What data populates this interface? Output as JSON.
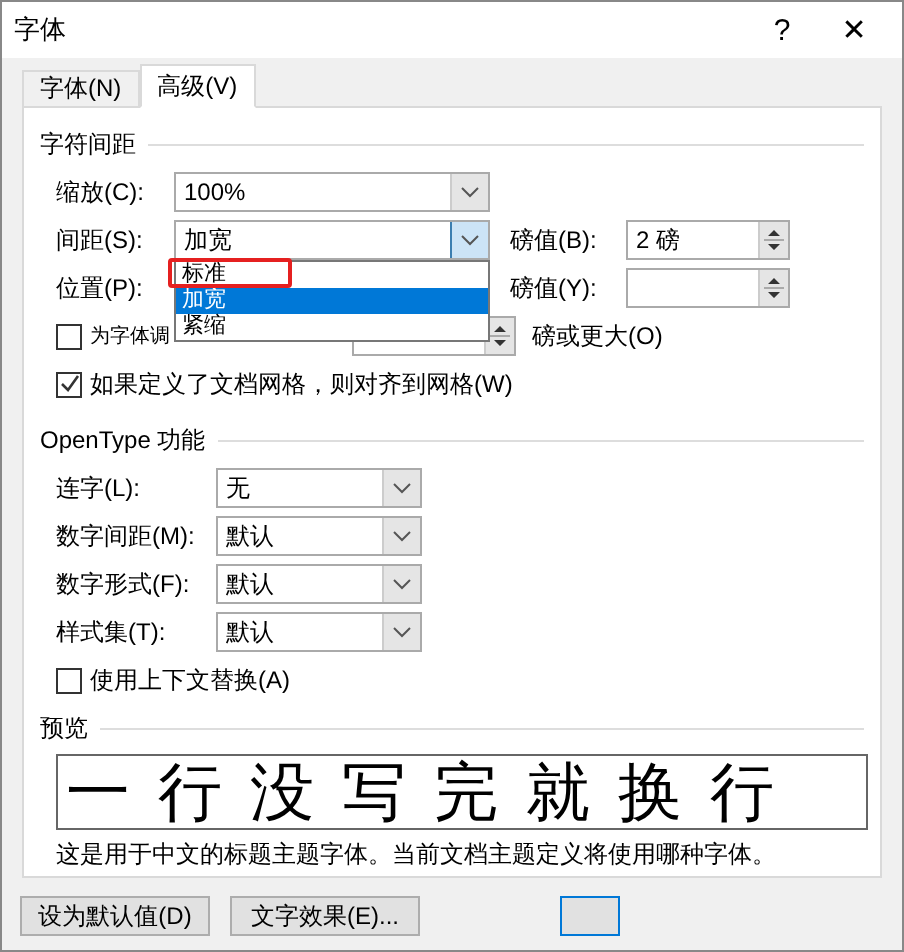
{
  "window": {
    "title": "字体",
    "help": "?",
    "close": "✕"
  },
  "tabs": [
    {
      "label": "字体(N)",
      "selected": false
    },
    {
      "label": "高级(V)",
      "selected": true
    }
  ],
  "spacing_section": {
    "title": "字符间距",
    "scale": {
      "label": "缩放(C):",
      "value": "100%"
    },
    "spacing": {
      "label": "间距(S):",
      "value": "加宽",
      "expanded": true,
      "options": [
        {
          "label": "标准",
          "selected": false
        },
        {
          "label": "加宽",
          "selected": true
        },
        {
          "label": "紧缩",
          "selected": false
        }
      ],
      "by_label": "磅值(B):",
      "by_value": "2 磅"
    },
    "position": {
      "label": "位置(P):",
      "by_label": "磅值(Y):"
    },
    "kerning": {
      "label": "为字体调",
      "checked": false,
      "suffix": "磅或更大(O)"
    },
    "grid": {
      "label": "如果定义了文档网格，则对齐到网格(W)",
      "checked": true
    }
  },
  "opentype_section": {
    "title": "OpenType 功能",
    "fields": [
      {
        "label": "连字(L):",
        "value": "无"
      },
      {
        "label": "数字间距(M):",
        "value": "默认"
      },
      {
        "label": "数字形式(F):",
        "value": "默认"
      },
      {
        "label": "样式集(T):",
        "value": "默认"
      }
    ],
    "contextual": {
      "label": "使用上下文替换(A)",
      "checked": false
    }
  },
  "preview_section": {
    "title": "预览",
    "sample": "一行没写完就换行",
    "description": "这是用于中文的标题主题字体。当前文档主题定义将使用哪种字体。"
  },
  "buttons": [
    {
      "label": "设为默认值(D)",
      "default": false
    },
    {
      "label": "文字效果(E)...",
      "default": false
    },
    {
      "default": true
    }
  ]
}
